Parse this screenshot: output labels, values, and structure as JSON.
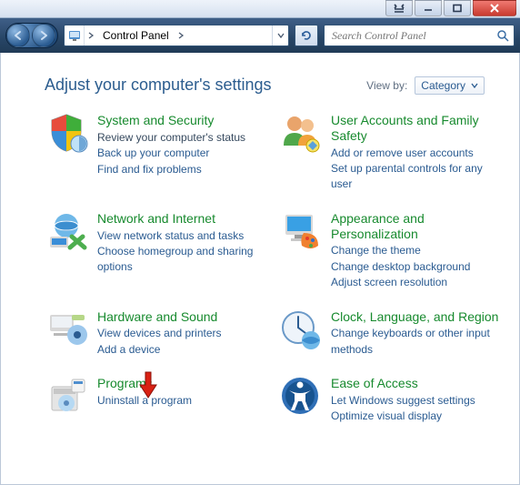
{
  "window": {
    "restore_label": "Restore Down",
    "minimize_label": "Minimize",
    "maximize_label": "Maximize",
    "close_label": "Close"
  },
  "address": {
    "location": "Control Panel"
  },
  "search": {
    "placeholder": "Search Control Panel"
  },
  "page": {
    "heading": "Adjust your computer's settings",
    "viewby_label": "View by:",
    "viewby_value": "Category"
  },
  "cats": {
    "system": {
      "title": "System and Security",
      "review": "Review your computer's status",
      "backup": "Back up your computer",
      "fix": "Find and fix problems"
    },
    "user": {
      "title": "User Accounts and Family Safety",
      "add": "Add or remove user accounts",
      "parental": "Set up parental controls for any user"
    },
    "network": {
      "title": "Network and Internet",
      "status": "View network status and tasks",
      "home": "Choose homegroup and sharing options"
    },
    "appearance": {
      "title": "Appearance and Personalization",
      "theme": "Change the theme",
      "bg": "Change desktop background",
      "res": "Adjust screen resolution"
    },
    "hardware": {
      "title": "Hardware and Sound",
      "dev": "View devices and printers",
      "add": "Add a device"
    },
    "clock": {
      "title": "Clock, Language, and Region",
      "kb": "Change keyboards or other input methods"
    },
    "programs": {
      "title": "Programs",
      "uninst": "Uninstall a program"
    },
    "ease": {
      "title": "Ease of Access",
      "suggest": "Let Windows suggest settings",
      "vis": "Optimize visual display"
    }
  }
}
